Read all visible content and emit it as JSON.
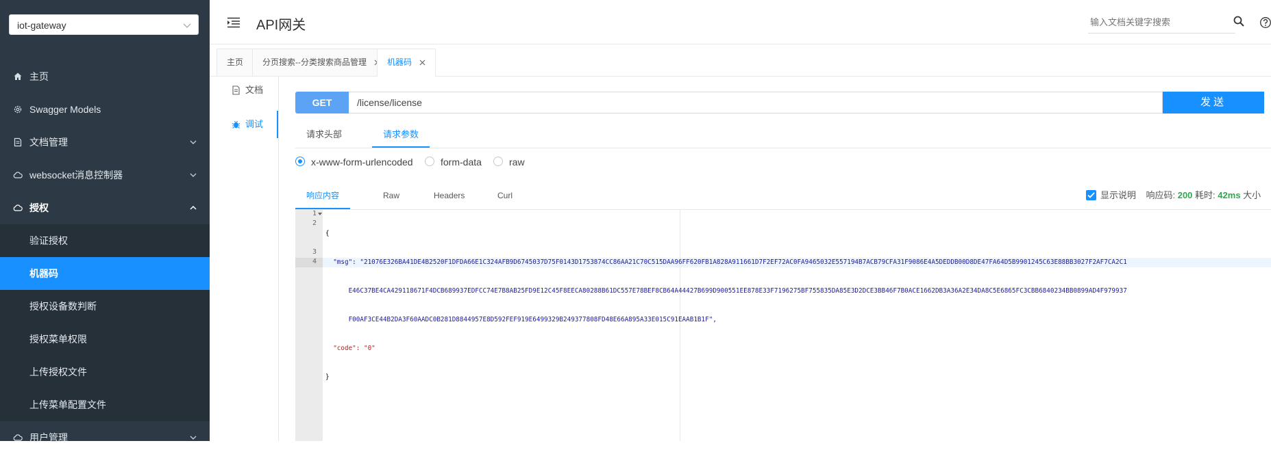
{
  "sidebar": {
    "project": "iot-gateway",
    "items": [
      {
        "label": "主页",
        "icon": "home-icon"
      },
      {
        "label": "Swagger Models",
        "icon": "settings-icon"
      },
      {
        "label": "文档管理",
        "icon": "document-icon"
      },
      {
        "label": "websocket消息控制器",
        "icon": "cloud-icon"
      },
      {
        "label": "授权",
        "icon": "cloud-icon"
      }
    ],
    "submenu": [
      {
        "label": "验证授权"
      },
      {
        "label": "机器码"
      },
      {
        "label": "授权设备数判断"
      },
      {
        "label": "授权菜单权限"
      },
      {
        "label": "上传授权文件"
      },
      {
        "label": "上传菜单配置文件"
      }
    ],
    "last_item": {
      "label": "用户管理",
      "icon": "cloud-icon"
    }
  },
  "header": {
    "title": "API网关",
    "search_placeholder": "输入文档关键字搜索"
  },
  "tabs": [
    {
      "label": "主页",
      "closable": false
    },
    {
      "label": "分页搜索--分类搜索商品管理",
      "closable": true
    },
    {
      "label": "机器码",
      "closable": true,
      "active": true
    }
  ],
  "side_tabs": {
    "doc": "文档",
    "debug": "调试"
  },
  "request": {
    "method": "GET",
    "url": "/license/license",
    "send": "发送"
  },
  "request_tabs": [
    "请求头部",
    "请求参数"
  ],
  "body_types": [
    "x-www-form-urlencoded",
    "form-data",
    "raw"
  ],
  "response_tabs": [
    "响应内容",
    "Raw",
    "Headers",
    "Curl"
  ],
  "response_meta": {
    "show_desc": "显示说明",
    "code_label": "响应码:",
    "code": "200",
    "time_label": "耗时:",
    "time": "42ms",
    "size_label": "大小"
  },
  "editor": {
    "line_numbers": [
      "1",
      "2",
      "",
      "",
      "3",
      "4"
    ],
    "lines": [
      "{",
      "  \"msg\": \"21076E326BA41DE4B2520F1DFDA66E1C324AFB9D6745037D75F0143D1753874CC86AA21C70C515DAA96FF620FB1A828A911661D7F2EF72AC0FA9465032E557194B7ACB79CFA31F9086E4A5DEDDB00D8DE47FA64D5B9901245C63E88BB3027F2AF7CA2C1",
      "      E46C37BE4CA429118671F4DCB689937EDFCC74E7B8AB25FD9E12C45F8EECA80288B61DC557E78BEF8CB64A44427B699D900551EE878E33F7196275BF755835DA85E3D2DCE3BB46F7B0ACE1662DB3A36A2E34DA8C5E6865FC3CBB6840234BB0899AD4F979937",
      "      F00AF3CE44B2DA3F60AADC0B281D8844957E8D592FEF919E6499329B249377808FD48E66A895A33E015C91EAAB1B1F\",",
      "  \"code\": \"0\"",
      "}"
    ]
  }
}
